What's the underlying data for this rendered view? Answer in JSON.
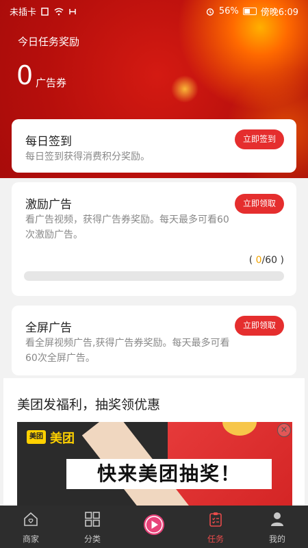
{
  "statusbar": {
    "carrier": "未插卡",
    "battery": "56%",
    "time": "傍晚6:09"
  },
  "rewards": {
    "title": "今日任务奖励",
    "amount": "0",
    "unit": "广告券"
  },
  "tasks": [
    {
      "title": "每日签到",
      "desc": "每日签到获得消费积分奖励。",
      "button": "立即签到"
    },
    {
      "title": "激励广告",
      "desc": "看广告视频，获得广告券奖励。每天最多可看60次激励广告。",
      "button": "立即领取",
      "progress_current": "0",
      "progress_total": "60",
      "progress_fraction": 0
    },
    {
      "title": "全屏广告",
      "desc": "看全屏视频广告,获得广告券奖励。每天最多可看60次全屏广告。",
      "button": "立即领取"
    }
  ],
  "promo": {
    "title": "美团发福利，抽奖领优惠",
    "banner_logo_box": "美团",
    "banner_logo": "美团",
    "banner_slogan": "快来美团抽奖！"
  },
  "tabs": [
    {
      "label": "商家",
      "icon": "home-heart-icon"
    },
    {
      "label": "分类",
      "icon": "grid-icon"
    },
    {
      "label": "",
      "icon": "play-icon"
    },
    {
      "label": "任务",
      "icon": "clipboard-icon"
    },
    {
      "label": "我的",
      "icon": "person-icon"
    }
  ],
  "colors": {
    "accent": "#e52e2e",
    "progress": "#f2a300",
    "tab_active": "#e84b4b"
  }
}
